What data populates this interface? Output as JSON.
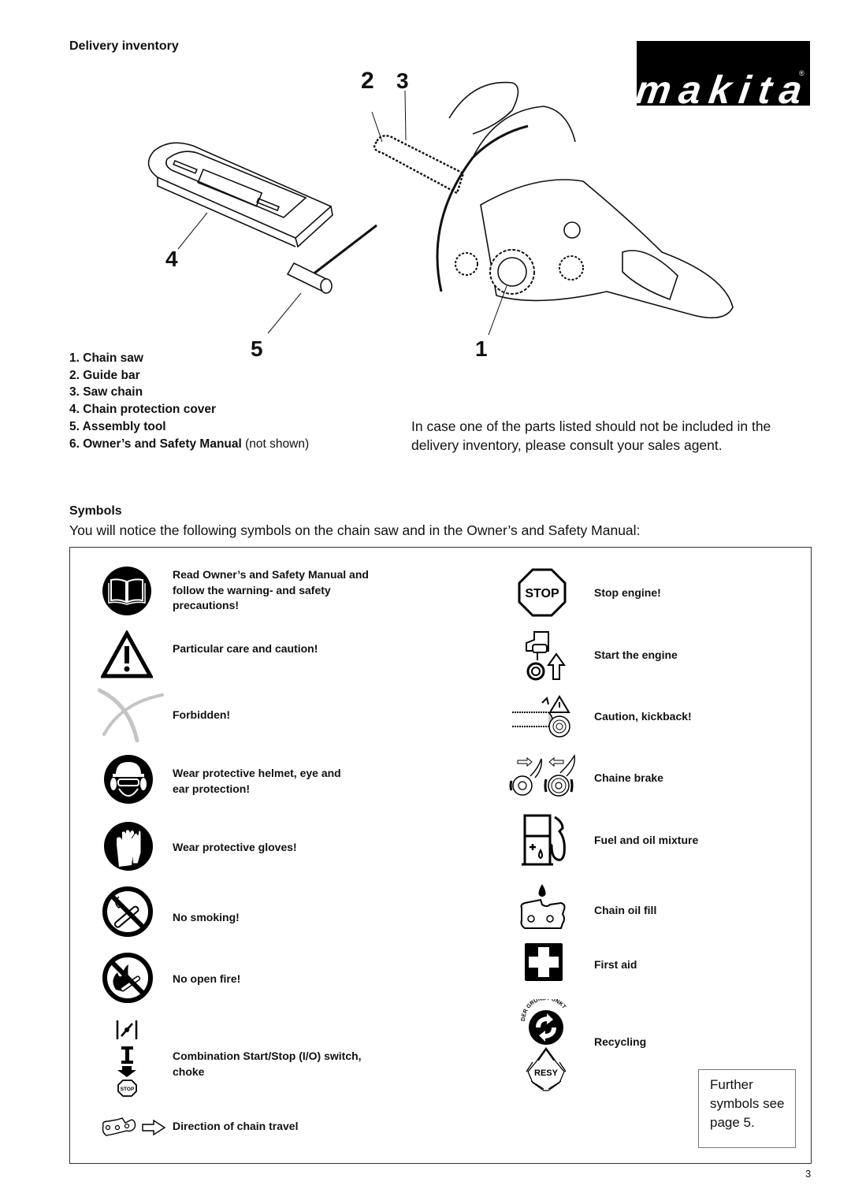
{
  "header": {
    "title": "Delivery inventory",
    "brand": "makita"
  },
  "illustration": {
    "callouts": [
      "1",
      "2",
      "3",
      "4",
      "5"
    ]
  },
  "inventory": {
    "items": [
      {
        "number": "1.",
        "label": "Chain saw",
        "note": ""
      },
      {
        "number": "2.",
        "label": "Guide bar",
        "note": ""
      },
      {
        "number": "3.",
        "label": "Saw chain",
        "note": ""
      },
      {
        "number": "4.",
        "label": "Chain protection cover",
        "note": ""
      },
      {
        "number": "5.",
        "label": "Assembly tool",
        "note": ""
      },
      {
        "number": "6.",
        "label": "Owner’s and Safety Manual",
        "note": "(not shown)"
      }
    ],
    "missing_note": "In case one of the parts listed should not be included in the delivery inventory, please consult your sales agent."
  },
  "symbols": {
    "title": "Symbols",
    "intro": "You will notice the following symbols on the chain saw and in the Owner’s and Safety Manual:",
    "left": [
      {
        "icon": "read-manual-icon",
        "label": "Read Owner’s and Safety Manual and follow the warning- and safety precautions!"
      },
      {
        "icon": "warning-triangle-icon",
        "label": "Particular care and caution!"
      },
      {
        "icon": "forbidden-cross-icon",
        "label": "Forbidden!"
      },
      {
        "icon": "helmet-protection-icon",
        "label": "Wear protective helmet, eye and ear protection!"
      },
      {
        "icon": "gloves-icon",
        "label": "Wear protective gloves!"
      },
      {
        "icon": "no-smoking-icon",
        "label": "No smoking!"
      },
      {
        "icon": "no-open-fire-icon",
        "label": "No open fire!"
      },
      {
        "icon": "start-stop-choke-icon",
        "label": "Combination Start/Stop (I/O) switch, choke"
      },
      {
        "icon": "chain-direction-icon",
        "label": "Direction of chain travel"
      }
    ],
    "right": [
      {
        "icon": "stop-sign-icon",
        "label": "Stop engine!"
      },
      {
        "icon": "start-engine-icon",
        "label": "Start the engine"
      },
      {
        "icon": "kickback-icon",
        "label": "Caution, kickback!"
      },
      {
        "icon": "chain-brake-icon",
        "label": "Chaine brake"
      },
      {
        "icon": "fuel-pump-icon",
        "label": "Fuel and oil mixture"
      },
      {
        "icon": "chain-oil-icon",
        "label": "Chain oil fill"
      },
      {
        "icon": "first-aid-icon",
        "label": "First aid"
      },
      {
        "icon": "recycling-icon",
        "label": "Recycling"
      }
    ],
    "stop_text": "STOP",
    "green_dot_text": "DER GRÜNE PUNKT",
    "resy_text": "RESY",
    "further": "Further symbols see page 5."
  },
  "footer": {
    "page_number": "3"
  }
}
